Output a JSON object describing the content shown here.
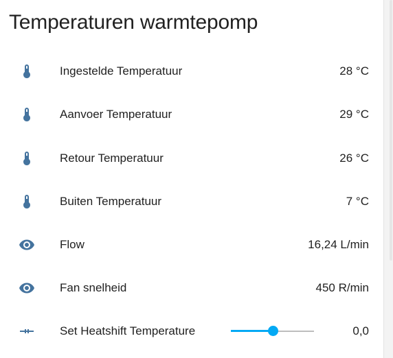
{
  "card": {
    "title": "Temperaturen warmtepomp"
  },
  "colors": {
    "icon": "#44739e",
    "slider_accent": "#03a9f4",
    "text": "#212121"
  },
  "entities": [
    {
      "icon": "thermometer-icon",
      "label": "Ingestelde Temperatuur",
      "value": "28 °C"
    },
    {
      "icon": "thermometer-icon",
      "label": "Aanvoer Temperatuur",
      "value": "29 °C"
    },
    {
      "icon": "thermometer-icon",
      "label": "Retour Temperatuur",
      "value": "26 °C"
    },
    {
      "icon": "thermometer-icon",
      "label": "Buiten Temperatuur",
      "value": "7 °C"
    },
    {
      "icon": "eye-icon",
      "label": "Flow",
      "value": "16,24 L/min"
    },
    {
      "icon": "eye-icon",
      "label": "Fan snelheid",
      "value": "450 R/min"
    }
  ],
  "slider_row": {
    "icon": "ray-vertex-icon",
    "label": "Set Heatshift Temperature",
    "value": "0,0",
    "slider_fraction": 0.5
  }
}
